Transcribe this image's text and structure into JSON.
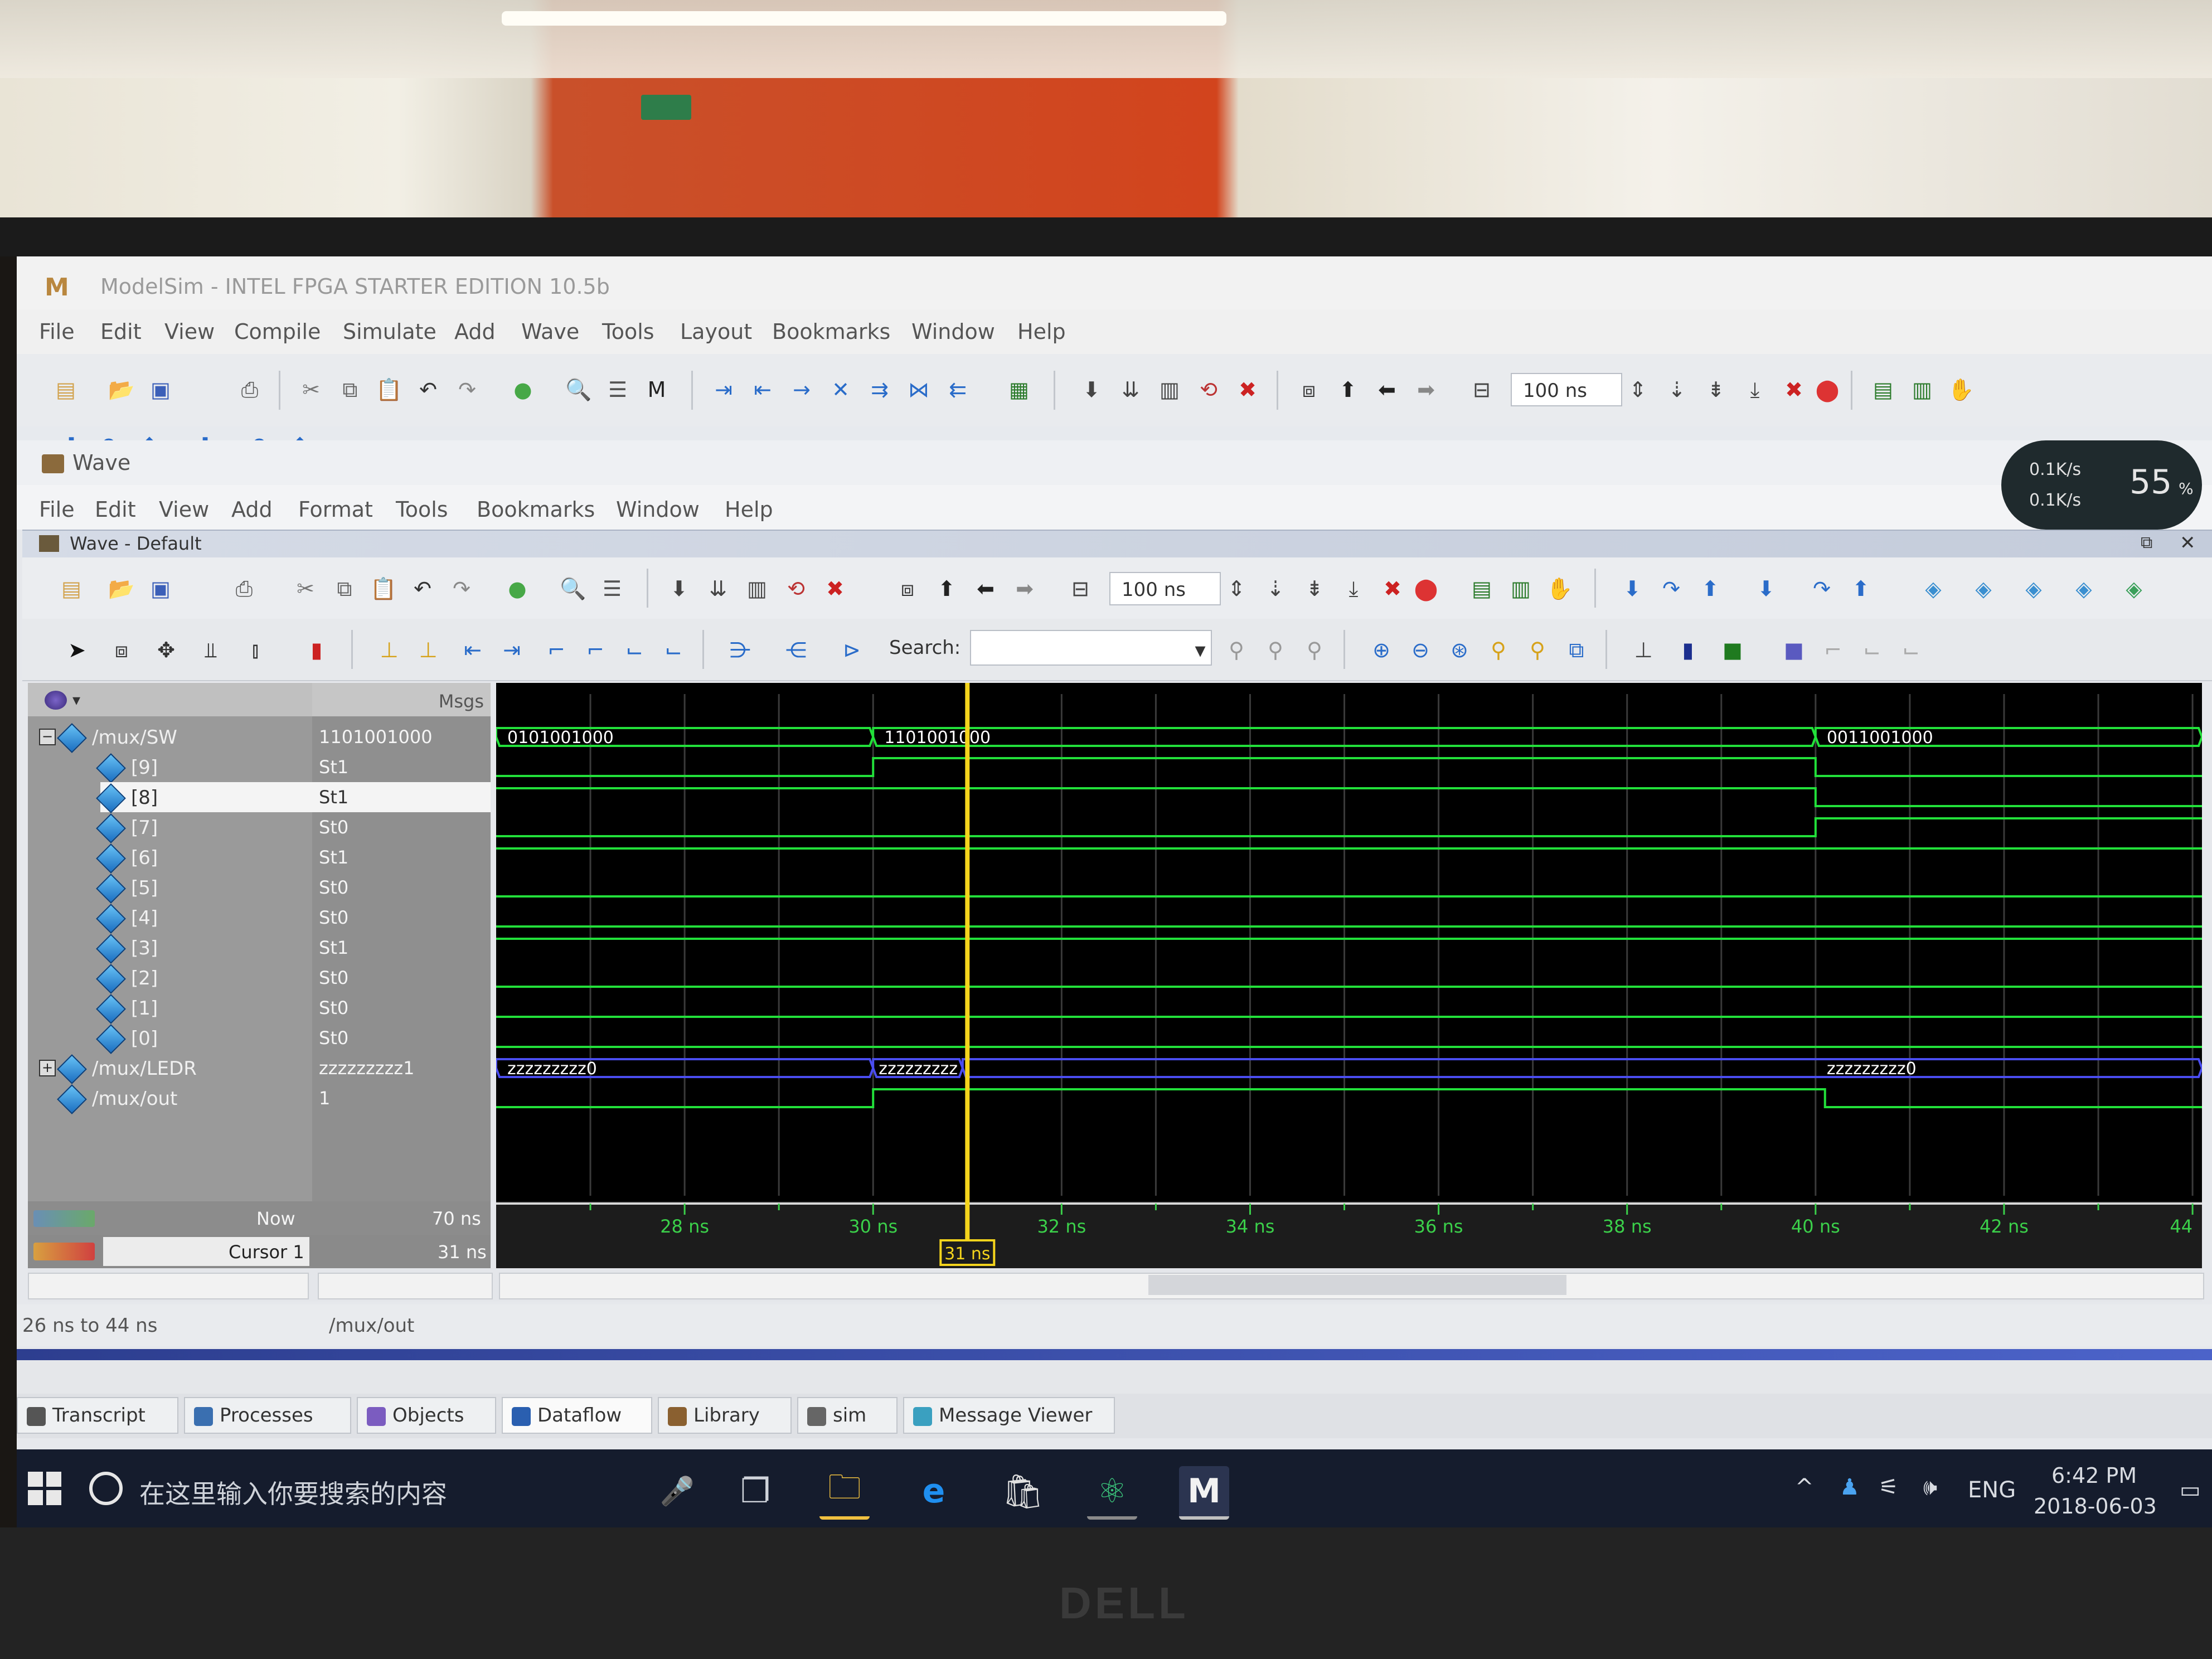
{
  "app": {
    "title": "ModelSim - INTEL FPGA STARTER EDITION 10.5b",
    "menu": [
      "File",
      "Edit",
      "View",
      "Compile",
      "Simulate",
      "Add",
      "Wave",
      "Tools",
      "Layout",
      "Bookmarks",
      "Window",
      "Help"
    ],
    "time_step": "100 ns"
  },
  "wave_window": {
    "title": "Wave",
    "menu": [
      "File",
      "Edit",
      "View",
      "Add",
      "Format",
      "Tools",
      "Bookmarks",
      "Window",
      "Help"
    ],
    "pane_title": "Wave - Default",
    "time_step": "100 ns",
    "search_label": "Search:",
    "msgs_header": "Msgs"
  },
  "signals": [
    {
      "name": "/mux/SW",
      "value": "1101001000",
      "expanded": true,
      "level": 0
    },
    {
      "name": "[9]",
      "value": "St1",
      "level": 1
    },
    {
      "name": "[8]",
      "value": "St1",
      "level": 1,
      "selected": true
    },
    {
      "name": "[7]",
      "value": "St0",
      "level": 1
    },
    {
      "name": "[6]",
      "value": "St1",
      "level": 1
    },
    {
      "name": "[5]",
      "value": "St0",
      "level": 1
    },
    {
      "name": "[4]",
      "value": "St0",
      "level": 1
    },
    {
      "name": "[3]",
      "value": "St1",
      "level": 1
    },
    {
      "name": "[2]",
      "value": "St0",
      "level": 1
    },
    {
      "name": "[1]",
      "value": "St0",
      "level": 1
    },
    {
      "name": "[0]",
      "value": "St0",
      "level": 1
    },
    {
      "name": "/mux/LEDR",
      "value": "zzzzzzzzz1",
      "expanded": false,
      "level": 0
    },
    {
      "name": "/mux/out",
      "value": "1",
      "level": 0
    }
  ],
  "wave_labels": {
    "sw_segments": [
      "0101001000",
      "1101001000",
      "0011001000"
    ],
    "ledr_segments": [
      "zzzzzzzzz0",
      "zzzzzzzzz",
      "zzzzzzzzz0"
    ]
  },
  "timeline": {
    "ticks": [
      "28 ns",
      "30 ns",
      "32 ns",
      "34 ns",
      "36 ns",
      "38 ns",
      "40 ns",
      "42 ns",
      "44"
    ],
    "now_label": "Now",
    "now_value": "70 ns",
    "cursor_label": "Cursor 1",
    "cursor_value": "31 ns",
    "cursor_marker": "31 ns"
  },
  "status": {
    "range": "26 ns to 44 ns",
    "selected_signal": "/mux/out"
  },
  "tabs": [
    "Transcript",
    "Processes",
    "Objects",
    "Dataflow",
    "Library",
    "sim",
    "Message Viewer"
  ],
  "taskbar": {
    "search_placeholder": "在这里输入你要搜索的内容",
    "language": "ENG",
    "time": "6:42 PM",
    "date": "2018-06-03"
  },
  "net_widget": {
    "up": "0.1K/s",
    "down": "0.1K/s",
    "percent": "55",
    "percent_symbol": "%"
  },
  "brand": "DELL",
  "colors": {
    "wave_green": "#22e03a",
    "bus_blue": "#4a4df0",
    "cursor_yellow": "#f4d41c",
    "grid": "#3a3a3a"
  }
}
